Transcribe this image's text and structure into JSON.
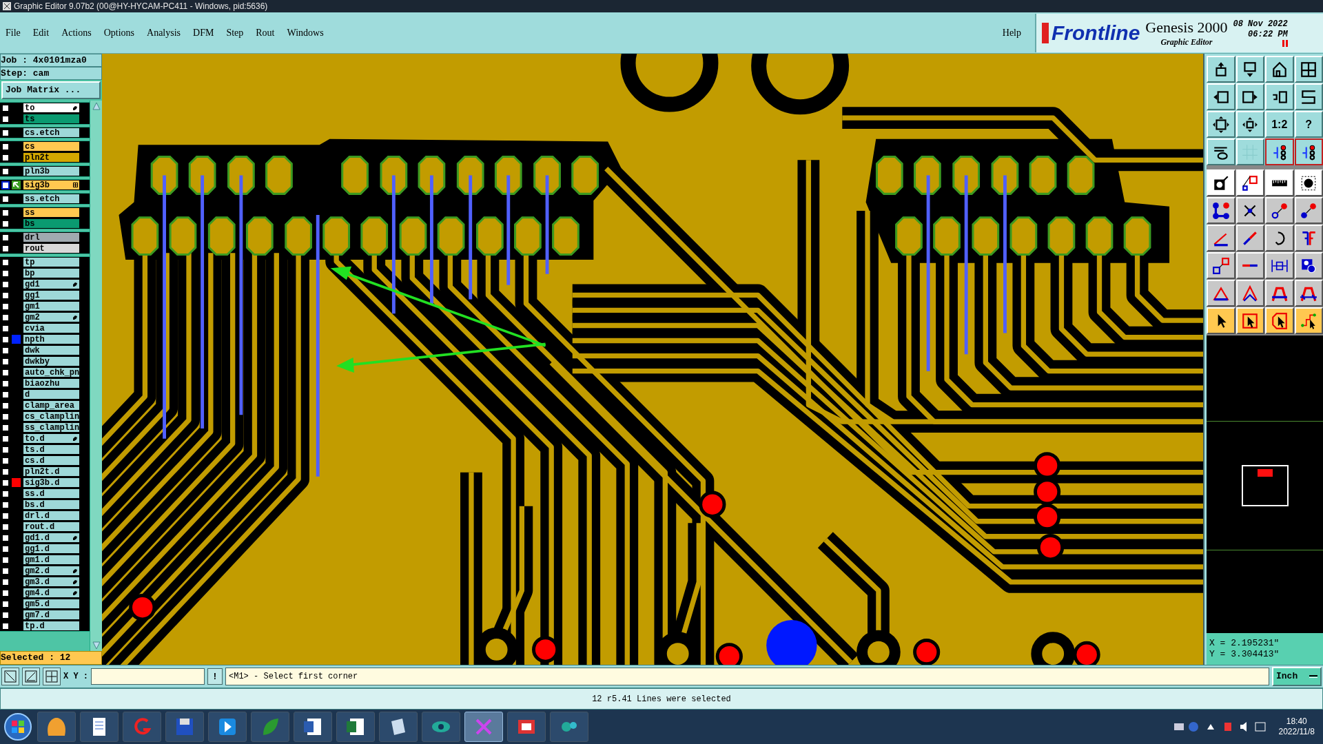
{
  "window": {
    "title": "Graphic Editor 9.07b2 (00@HY-HYCAM-PC411 - Windows, pid:5636)"
  },
  "menu": {
    "items": [
      "File",
      "Edit",
      "Actions",
      "Options",
      "Analysis",
      "DFM",
      "Step",
      "Rout",
      "Windows"
    ],
    "help": "Help"
  },
  "brand": {
    "logo": "Frontline",
    "product": "Genesis 2000",
    "subtitle": "Graphic Editor",
    "date": "08 Nov 2022",
    "time": "06:22 PM"
  },
  "job_panel": {
    "job": "Job : 4x0101mza0",
    "step": "Step: cam",
    "matrix_button": "Job Matrix ...",
    "layer_groups": [
      [
        {
          "name": "to",
          "color": "#ffffff",
          "hand": true,
          "grid_mark": false,
          "work": false,
          "checked": false
        },
        {
          "name": "ts",
          "color": "#0a9a70",
          "hand": false,
          "grid_mark": false,
          "work": false,
          "checked": false
        }
      ],
      [
        {
          "name": "cs.etch",
          "color": "#9ed8d8",
          "hand": false,
          "grid_mark": false,
          "work": false,
          "checked": false
        }
      ],
      [
        {
          "name": "cs",
          "color": "#ffc850",
          "hand": false,
          "grid_mark": false,
          "work": false,
          "checked": false
        },
        {
          "name": "pln2t",
          "color": "#d4a800",
          "hand": false,
          "grid_mark": false,
          "work": false,
          "checked": false
        }
      ],
      [
        {
          "name": "pln3b",
          "color": "#9ed8d8",
          "hand": false,
          "grid_mark": false,
          "work": false,
          "checked": false
        }
      ],
      [
        {
          "name": "sig3b",
          "color": "#ffc850",
          "hand": false,
          "grid_mark": true,
          "work": true,
          "checked": false
        }
      ],
      [
        {
          "name": "ss.etch",
          "color": "#9ed8d8",
          "hand": false,
          "grid_mark": false,
          "work": false,
          "checked": false
        }
      ],
      [
        {
          "name": "ss",
          "color": "#ffc850",
          "hand": false,
          "grid_mark": false,
          "work": false,
          "checked": false
        },
        {
          "name": "bs",
          "color": "#0a9a70",
          "hand": false,
          "grid_mark": false,
          "work": false,
          "checked": false
        }
      ],
      [
        {
          "name": "drl",
          "color": "#a0aab0",
          "hand": false,
          "grid_mark": false,
          "work": false,
          "checked": false
        },
        {
          "name": "rout",
          "color": "#d8d8d8",
          "hand": false,
          "grid_mark": false,
          "work": false,
          "checked": false
        }
      ],
      [
        {
          "name": "tp",
          "color": "#9ed8d8",
          "hand": false,
          "grid_mark": false,
          "work": false,
          "checked": false
        },
        {
          "name": "bp",
          "color": "#9ed8d8",
          "hand": false,
          "grid_mark": false,
          "work": false,
          "checked": false
        },
        {
          "name": "gd1",
          "color": "#9ed8d8",
          "hand": true,
          "grid_mark": false,
          "work": false,
          "checked": false
        },
        {
          "name": "gg1",
          "color": "#9ed8d8",
          "hand": false,
          "grid_mark": false,
          "work": false,
          "checked": false
        },
        {
          "name": "gm1",
          "color": "#9ed8d8",
          "hand": false,
          "grid_mark": false,
          "work": false,
          "checked": false
        },
        {
          "name": "gm2",
          "color": "#9ed8d8",
          "hand": true,
          "grid_mark": false,
          "work": false,
          "checked": false
        },
        {
          "name": "cvia",
          "color": "#9ed8d8",
          "hand": false,
          "grid_mark": false,
          "work": false,
          "checked": false
        },
        {
          "name": "npth",
          "color": "#9ed8d8",
          "hand": false,
          "grid_mark": false,
          "work": false,
          "checked": false,
          "swatch": {
            "color": "#0022ff"
          }
        },
        {
          "name": "dwk",
          "color": "#9ed8d8",
          "hand": false,
          "grid_mark": false,
          "work": false,
          "checked": false
        },
        {
          "name": "dwkby",
          "color": "#9ed8d8",
          "hand": false,
          "grid_mark": false,
          "work": false,
          "checked": false
        },
        {
          "name": "auto_chk_pn",
          "color": "#9ed8d8",
          "hand": false,
          "grid_mark": false,
          "work": false,
          "checked": false
        },
        {
          "name": "biaozhu",
          "color": "#9ed8d8",
          "hand": false,
          "grid_mark": false,
          "work": false,
          "checked": false
        },
        {
          "name": "d",
          "color": "#9ed8d8",
          "hand": false,
          "grid_mark": false,
          "work": false,
          "checked": false
        },
        {
          "name": "clamp_area",
          "color": "#9ed8d8",
          "hand": false,
          "grid_mark": false,
          "work": false,
          "checked": false
        },
        {
          "name": "cs_clamplin",
          "color": "#9ed8d8",
          "hand": false,
          "grid_mark": false,
          "work": false,
          "checked": false
        },
        {
          "name": "ss_clamplin",
          "color": "#9ed8d8",
          "hand": false,
          "grid_mark": false,
          "work": false,
          "checked": false
        },
        {
          "name": "to.d",
          "color": "#9ed8d8",
          "hand": true,
          "grid_mark": false,
          "work": false,
          "checked": false
        },
        {
          "name": "ts.d",
          "color": "#9ed8d8",
          "hand": false,
          "grid_mark": false,
          "work": false,
          "checked": false
        },
        {
          "name": "cs.d",
          "color": "#9ed8d8",
          "hand": false,
          "grid_mark": false,
          "work": false,
          "checked": false
        },
        {
          "name": "pln2t.d",
          "color": "#9ed8d8",
          "hand": false,
          "grid_mark": false,
          "work": false,
          "checked": false
        },
        {
          "name": "sig3b.d",
          "color": "#9ed8d8",
          "hand": false,
          "grid_mark": false,
          "work": false,
          "checked": false,
          "swatch": {
            "color": "#ff0000"
          }
        },
        {
          "name": "ss.d",
          "color": "#9ed8d8",
          "hand": false,
          "grid_mark": false,
          "work": false,
          "checked": false
        },
        {
          "name": "bs.d",
          "color": "#9ed8d8",
          "hand": false,
          "grid_mark": false,
          "work": false,
          "checked": false
        },
        {
          "name": "drl.d",
          "color": "#9ed8d8",
          "hand": false,
          "grid_mark": false,
          "work": false,
          "checked": false
        },
        {
          "name": "rout.d",
          "color": "#9ed8d8",
          "hand": false,
          "grid_mark": false,
          "work": false,
          "checked": false
        },
        {
          "name": "gd1.d",
          "color": "#9ed8d8",
          "hand": true,
          "grid_mark": false,
          "work": false,
          "checked": false
        },
        {
          "name": "gg1.d",
          "color": "#9ed8d8",
          "hand": false,
          "grid_mark": false,
          "work": false,
          "checked": false
        },
        {
          "name": "gm1.d",
          "color": "#9ed8d8",
          "hand": false,
          "grid_mark": false,
          "work": false,
          "checked": false
        },
        {
          "name": "gm2.d",
          "color": "#9ed8d8",
          "hand": true,
          "grid_mark": false,
          "work": false,
          "checked": false
        },
        {
          "name": "gm3.d",
          "color": "#9ed8d8",
          "hand": true,
          "grid_mark": false,
          "work": false,
          "checked": false
        },
        {
          "name": "gm4.d",
          "color": "#9ed8d8",
          "hand": true,
          "grid_mark": false,
          "work": false,
          "checked": false
        },
        {
          "name": "gm5.d",
          "color": "#9ed8d8",
          "hand": false,
          "grid_mark": false,
          "work": false,
          "checked": false
        },
        {
          "name": "gm7.d",
          "color": "#9ed8d8",
          "hand": false,
          "grid_mark": false,
          "work": false,
          "checked": false
        },
        {
          "name": "tp.d",
          "color": "#9ed8d8",
          "hand": false,
          "grid_mark": false,
          "work": false,
          "checked": false
        }
      ]
    ],
    "selected_count": "Selected : 12"
  },
  "view_buttons": [
    {
      "selected": false
    },
    {
      "selected": false
    },
    {
      "selected": false
    },
    {
      "selected": false
    },
    {
      "selected": false
    },
    {
      "selected": false
    },
    {
      "selected": false
    },
    {
      "selected": false
    },
    {
      "selected": false
    },
    {
      "selected": false
    },
    {
      "label": "1:2",
      "selected": false
    },
    {
      "label": "?",
      "selected": false
    },
    {
      "selected": false
    },
    {
      "selected": false
    },
    {
      "selected": true
    },
    {
      "selected": true
    }
  ],
  "readout": {
    "x": "X = 2.195231\"",
    "y": "Y = 3.304413\""
  },
  "command_bar": {
    "xy_label": "X Y :",
    "bang": "!",
    "prompt": "<M1> - Select first corner",
    "units": "Inch"
  },
  "status": "12 r5.41 Lines were selected",
  "taskbar": {
    "time": "18:40",
    "date": "2022/11/8"
  }
}
